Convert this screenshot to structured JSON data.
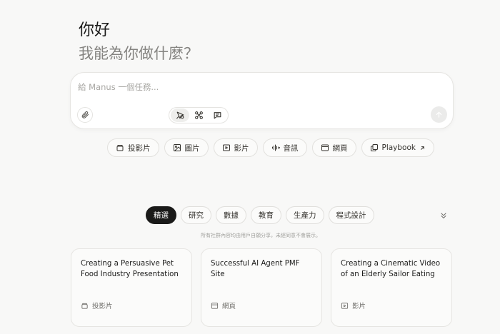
{
  "greeting": {
    "title": "你好",
    "subtitle": "我能為你做什麼？"
  },
  "composer": {
    "placeholder": "給 Manus 一個任務...",
    "value": "",
    "tools": [
      "browser-tool-icon",
      "connectors-icon",
      "chat-mode-icon"
    ],
    "active_tool": 0
  },
  "quick_actions": [
    {
      "label": "投影片",
      "icon": "slides-icon"
    },
    {
      "label": "圖片",
      "icon": "image-icon"
    },
    {
      "label": "影片",
      "icon": "video-icon"
    },
    {
      "label": "音訊",
      "icon": "audio-icon"
    },
    {
      "label": "網頁",
      "icon": "webpage-icon"
    },
    {
      "label": "Playbook",
      "icon": "playbook-icon"
    }
  ],
  "categories": [
    "精選",
    "研究",
    "數據",
    "教育",
    "生產力",
    "程式設計"
  ],
  "active_category": 0,
  "disclaimer": "所有社群內容均由用戶自願分享，未經同意不會展示。",
  "cards": [
    {
      "title": "Creating a Persuasive Pet Food Industry Presentation",
      "type": "投影片",
      "icon": "slides-icon"
    },
    {
      "title": "Successful AI Agent PMF Site",
      "type": "網頁",
      "icon": "webpage-icon"
    },
    {
      "title": "Creating a Cinematic Video of an Elderly Sailor Eating",
      "type": "影片",
      "icon": "video-icon"
    }
  ],
  "colors": {
    "background": "#f8f8f7",
    "active_pill": "#1a1a19",
    "text": "#34322d",
    "muted_text": "#858481"
  }
}
